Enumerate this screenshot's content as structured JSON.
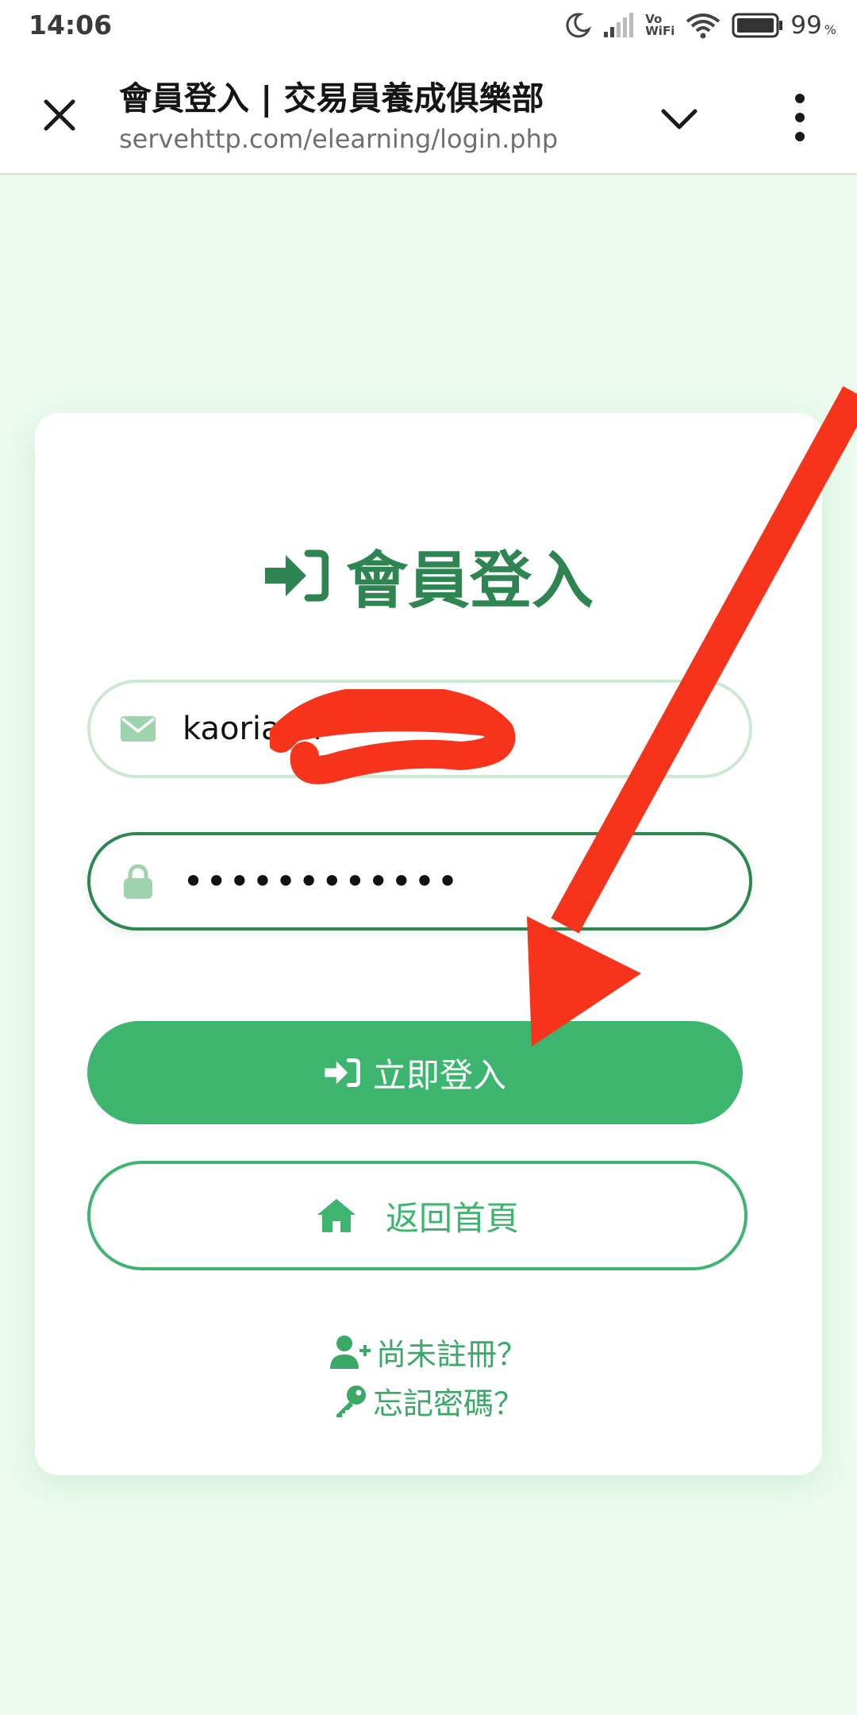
{
  "status_bar": {
    "time": "14:06",
    "vowifi_top": "Vo",
    "vowifi_bottom": "WiFi",
    "battery_level": "99",
    "battery_unit": "%"
  },
  "browser": {
    "title": "會員登入 | 交易員養成俱樂部",
    "url": "servehttp.com/elearning/login.php"
  },
  "login": {
    "heading": "會員登入",
    "email_value": "kaoria                         m",
    "password_value": "••••••••••••",
    "submit_label": "立即登入",
    "home_label": "返回首頁",
    "register_label": "尚未註冊？",
    "forgot_label": "忘記密碼？"
  },
  "colors": {
    "page_bg": "#ecfbee",
    "brand_dark": "#2f8552",
    "brand": "#3db56f",
    "icon_light": "#9fd3ad",
    "annotation": "#f5341b"
  }
}
